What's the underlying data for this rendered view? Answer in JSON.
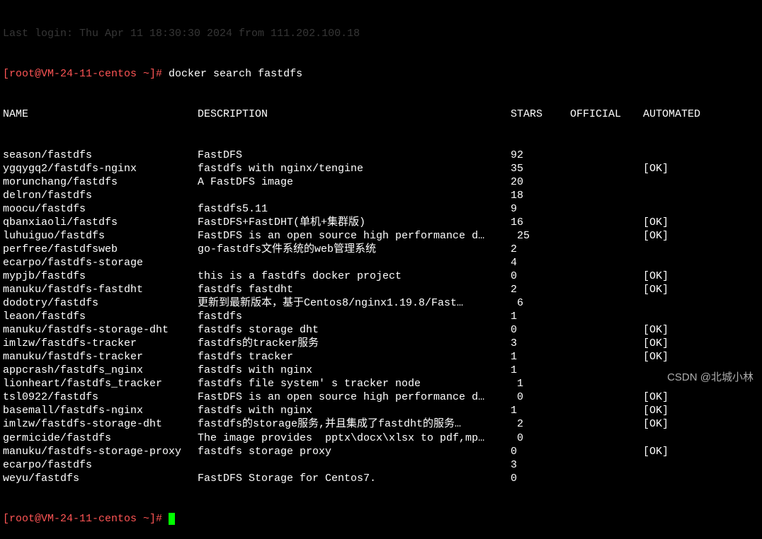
{
  "login_line": "Last login: Thu Apr 11 18:30:30 2024 from 111.202.100.18",
  "prompt_user": "[root@VM-24-11-centos ~]# ",
  "command": "docker search fastdfs",
  "headers": {
    "name": "NAME",
    "description": "DESCRIPTION",
    "stars": "STARS",
    "official": "OFFICIAL",
    "automated": "AUTOMATED"
  },
  "rows": [
    {
      "name": "season/fastdfs",
      "desc": "FastDFS",
      "stars": "92",
      "official": "",
      "automated": ""
    },
    {
      "name": "ygqygq2/fastdfs-nginx",
      "desc": "fastdfs with nginx/tengine",
      "stars": "35",
      "official": "",
      "automated": "[OK]"
    },
    {
      "name": "morunchang/fastdfs",
      "desc": "A FastDFS image",
      "stars": "20",
      "official": "",
      "automated": ""
    },
    {
      "name": "delron/fastdfs",
      "desc": "",
      "stars": "18",
      "official": "",
      "automated": ""
    },
    {
      "name": "moocu/fastdfs",
      "desc": "fastdfs5.11",
      "stars": "9",
      "official": "",
      "automated": ""
    },
    {
      "name": "qbanxiaoli/fastdfs",
      "desc": "FastDFS+FastDHT(单机+集群版)",
      "stars": "16",
      "official": "",
      "automated": "[OK]"
    },
    {
      "name": "luhuiguo/fastdfs",
      "desc": "FastDFS is an open source high performance d…",
      "stars": " 25",
      "official": "",
      "automated": "[OK]"
    },
    {
      "name": "perfree/fastdfsweb",
      "desc": "go-fastdfs文件系统的web管理系统",
      "stars": "2",
      "official": "",
      "automated": ""
    },
    {
      "name": "ecarpo/fastdfs-storage",
      "desc": "",
      "stars": "4",
      "official": "",
      "automated": ""
    },
    {
      "name": "mypjb/fastdfs",
      "desc": "this is a fastdfs docker project",
      "stars": "0",
      "official": "",
      "automated": "[OK]"
    },
    {
      "name": "manuku/fastdfs-fastdht",
      "desc": "fastdfs fastdht",
      "stars": "2",
      "official": "",
      "automated": "[OK]"
    },
    {
      "name": "dodotry/fastdfs",
      "desc": "更新到最新版本，基于Centos8/nginx1.19.8/Fast…",
      "stars": " 6",
      "official": "",
      "automated": ""
    },
    {
      "name": "leaon/fastdfs",
      "desc": "fastdfs",
      "stars": "1",
      "official": "",
      "automated": ""
    },
    {
      "name": "manuku/fastdfs-storage-dht",
      "desc": "fastdfs storage dht",
      "stars": "0",
      "official": "",
      "automated": "[OK]"
    },
    {
      "name": "imlzw/fastdfs-tracker",
      "desc": "fastdfs的tracker服务",
      "stars": "3",
      "official": "",
      "automated": "[OK]"
    },
    {
      "name": "manuku/fastdfs-tracker",
      "desc": "fastdfs tracker",
      "stars": "1",
      "official": "",
      "automated": "[OK]"
    },
    {
      "name": "appcrash/fastdfs_nginx",
      "desc": "fastdfs with nginx",
      "stars": "1",
      "official": "",
      "automated": ""
    },
    {
      "name": "lionheart/fastdfs_tracker",
      "desc": "fastdfs file system' s tracker node",
      "stars": " 1",
      "official": "",
      "automated": ""
    },
    {
      "name": "tsl0922/fastdfs",
      "desc": "FastDFS is an open source high performance d…",
      "stars": " 0",
      "official": "",
      "automated": "[OK]"
    },
    {
      "name": "basemall/fastdfs-nginx",
      "desc": "fastdfs with nginx",
      "stars": "1",
      "official": "",
      "automated": "[OK]"
    },
    {
      "name": "imlzw/fastdfs-storage-dht",
      "desc": "fastdfs的storage服务,并且集成了fastdht的服务…",
      "stars": " 2",
      "official": "",
      "automated": "[OK]"
    },
    {
      "name": "germicide/fastdfs",
      "desc": "The image provides  pptx\\docx\\xlsx to pdf,mp…",
      "stars": " 0",
      "official": "",
      "automated": ""
    },
    {
      "name": "manuku/fastdfs-storage-proxy",
      "desc": "fastdfs storage proxy",
      "stars": "0",
      "official": "",
      "automated": "[OK]"
    },
    {
      "name": "ecarpo/fastdfs",
      "desc": "",
      "stars": "3",
      "official": "",
      "automated": ""
    },
    {
      "name": "weyu/fastdfs",
      "desc": "FastDFS Storage for Centos7.",
      "stars": "0",
      "official": "",
      "automated": ""
    }
  ],
  "prompt2_user": "[root@VM-24-11-centos ~]# ",
  "watermark": "CSDN @北城小林"
}
